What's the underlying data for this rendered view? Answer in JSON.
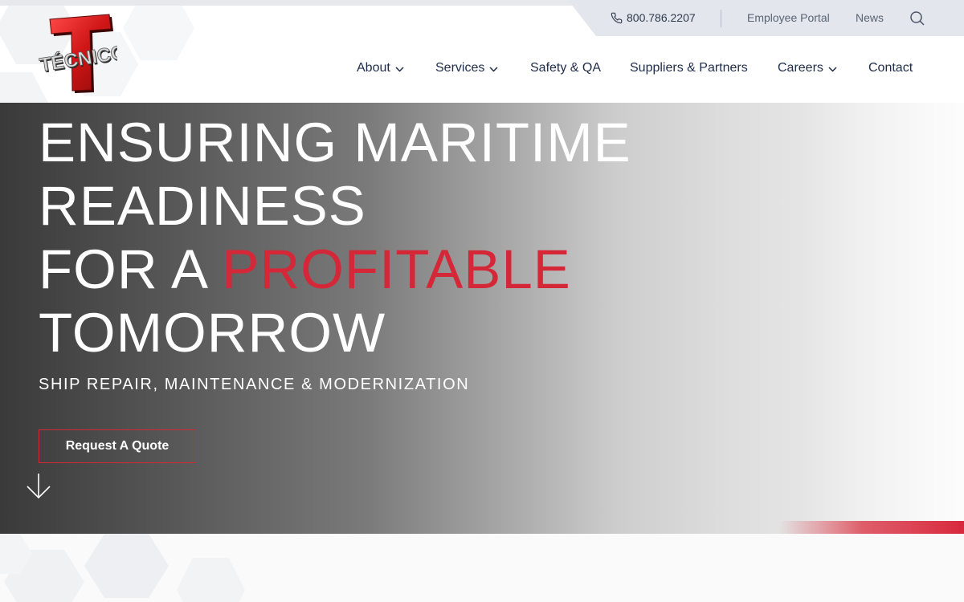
{
  "brand": {
    "logo_text": "TÉCNICO",
    "logo_letter": "T",
    "accent_color": "#d42838",
    "nav_text_color": "#1f2d4a"
  },
  "utility": {
    "phone": "800.786.2207",
    "employee_portal": "Employee Portal",
    "news": "News",
    "icons": [
      "phone-icon",
      "search-icon"
    ]
  },
  "nav": {
    "about": "About",
    "services": "Services",
    "safety": "Safety & QA",
    "suppliers": "Suppliers & Partners",
    "careers": "Careers",
    "contact": "Contact"
  },
  "hero": {
    "line1": "ENSURING MARITIME",
    "line2": "READINESS",
    "line3_prefix": "FOR A ",
    "line3_accent": "PROFITABLE",
    "line4": "TOMORROW",
    "subtitle": "SHIP REPAIR, MAINTENANCE & MODERNIZATION",
    "cta": "Request A Quote"
  }
}
